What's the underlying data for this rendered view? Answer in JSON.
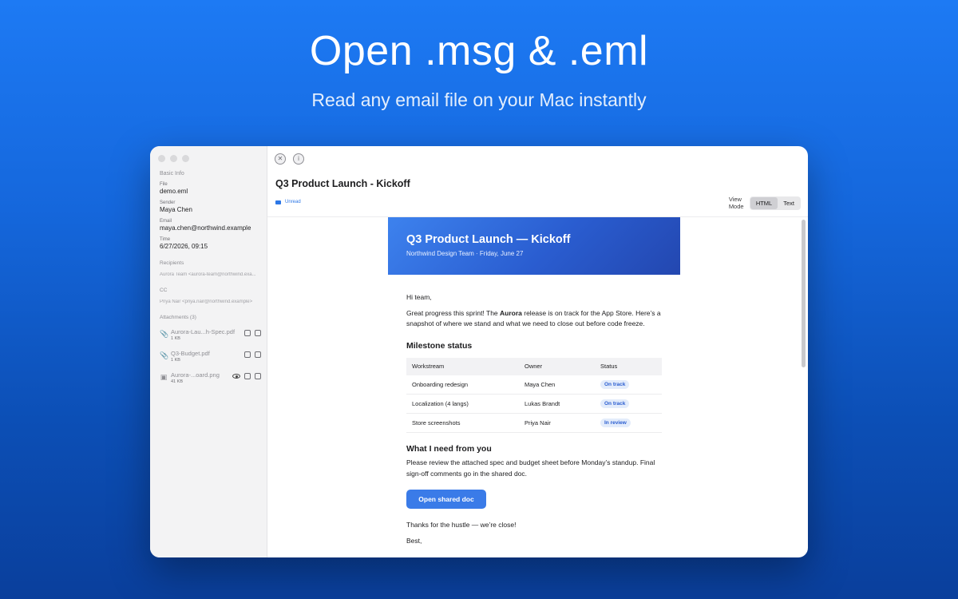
{
  "hero": {
    "title": "Open .msg & .eml",
    "subtitle": "Read any email file on your Mac instantly"
  },
  "sidebar": {
    "section_title": "Basic Info",
    "file_label": "File",
    "file_value": "demo.eml",
    "sender_label": "Sender",
    "sender_value": "Maya Chen",
    "email_label": "Email",
    "email_value": "maya.chen@northwind.example",
    "time_label": "Time",
    "time_value": "6/27/2026, 09:15",
    "recipients_label": "Recipients",
    "recipients_value": "Aurora Team <aurora-team@northwind.exa...",
    "cc_label": "CC",
    "cc_value": "Priya Nair <priya.nair@northwind.example>",
    "attachments_label": "Attachments (3)",
    "attachments": [
      {
        "name": "Aurora-Lau...h-Spec.pdf",
        "size": "1 KB",
        "icon": "paperclip-icon"
      },
      {
        "name": "Q3-Budget.pdf",
        "size": "1 KB",
        "icon": "paperclip-icon"
      },
      {
        "name": "Aurora-...oard.png",
        "size": "41 KB",
        "icon": "image-icon"
      }
    ]
  },
  "toolbar": {
    "close_icon": "close-icon",
    "info_icon": "info-icon"
  },
  "header": {
    "subject": "Q3 Product Launch - Kickoff",
    "status": "Unread",
    "view_mode_label": "View Mode",
    "view_modes": [
      "HTML",
      "Text"
    ],
    "selected_view_mode": "HTML"
  },
  "email": {
    "banner_title": "Q3 Product Launch — Kickoff",
    "banner_subtitle": "Northwind Design Team · Friday, June 27",
    "greeting": "Hi team,",
    "intro_pre": "Great progress this sprint! The ",
    "intro_bold": "Aurora",
    "intro_post": " release is on track for the App Store. Here’s a snapshot of where we stand and what we need to close out before code freeze.",
    "milestone_heading": "Milestone status",
    "table": {
      "headers": [
        "Workstream",
        "Owner",
        "Status"
      ],
      "rows": [
        [
          "Onboarding redesign",
          "Maya Chen",
          "On track"
        ],
        [
          "Localization (4 langs)",
          "Lukas Brandt",
          "On track"
        ],
        [
          "Store screenshots",
          "Priya Nair",
          "In review"
        ]
      ]
    },
    "need_heading": "What I need from you",
    "need_text": "Please review the attached spec and budget sheet before Monday’s standup. Final sign-off comments go in the shared doc.",
    "cta_label": "Open shared doc",
    "thanks": "Thanks for the hustle — we’re close!",
    "signoff": "Best,"
  },
  "colors": {
    "accent": "#3a7be8",
    "banner_start": "#3d82ee",
    "banner_end": "#2347b0",
    "pill_bg": "#e3ecfb",
    "pill_text": "#2a5dd0"
  }
}
